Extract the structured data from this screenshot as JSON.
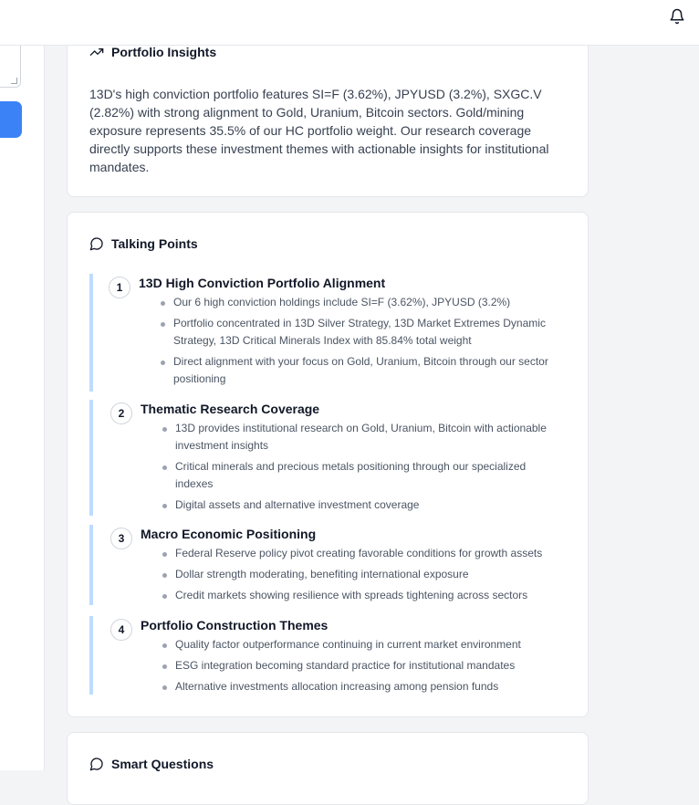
{
  "header": {
    "notifications_icon": "bell-icon"
  },
  "insights": {
    "icon": "trending-up-icon",
    "title": "Portfolio Insights",
    "body": "13D's high conviction portfolio features SI=F (3.62%), JPYUSD (3.2%), SXGC.V (2.82%) with strong alignment to Gold, Uranium, Bitcoin sectors. Gold/mining exposure represents 35.5% of our HC portfolio weight. Our research coverage directly supports these investment themes with actionable insights for institutional mandates."
  },
  "talking_points": {
    "icon": "message-circle-icon",
    "title": "Talking Points",
    "items": [
      {
        "number": "1",
        "title": "13D High Conviction Portfolio Alignment",
        "bullets": [
          "Our 6 high conviction holdings include SI=F (3.62%), JPYUSD (3.2%)",
          "Portfolio concentrated in 13D Silver Strategy, 13D Market Extremes Dynamic Strategy, 13D Critical Minerals Index with 85.84% total weight",
          "Direct alignment with your focus on Gold, Uranium, Bitcoin through our sector positioning"
        ]
      },
      {
        "number": "2",
        "title": "Thematic Research Coverage",
        "bullets": [
          "13D provides institutional research on Gold, Uranium, Bitcoin with actionable investment insights",
          "Critical minerals and precious metals positioning through our specialized indexes",
          "Digital assets and alternative investment coverage"
        ]
      },
      {
        "number": "3",
        "title": "Macro Economic Positioning",
        "bullets": [
          "Federal Reserve policy pivot creating favorable conditions for growth assets",
          "Dollar strength moderating, benefiting international exposure",
          "Credit markets showing resilience with spreads tightening across sectors"
        ]
      },
      {
        "number": "4",
        "title": "Portfolio Construction Themes",
        "bullets": [
          "Quality factor outperformance continuing in current market environment",
          "ESG integration becoming standard practice for institutional mandates",
          "Alternative investments allocation increasing among pension funds"
        ]
      }
    ]
  },
  "smart_questions": {
    "icon": "message-circle-icon",
    "title": "Smart Questions"
  },
  "colors": {
    "accent": "#3b82f6",
    "item_border": "#bfdbfe",
    "background": "#f3f4f6"
  }
}
